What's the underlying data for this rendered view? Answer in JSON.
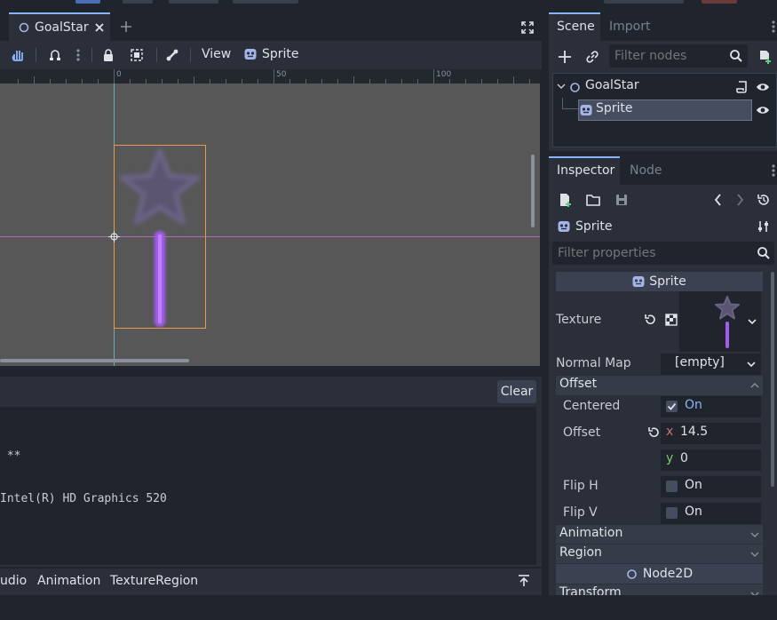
{
  "editor": {
    "scene_tab": {
      "label": "GoalStar"
    },
    "toolbar": {
      "view_label": "View",
      "sprite_label": "Sprite"
    },
    "ruler": {
      "ticks": [
        "0",
        "50",
        "100"
      ]
    }
  },
  "output": {
    "clear_label": "Clear",
    "lines": [
      " **",
      "Intel(R) HD Graphics 520",
      "",
      " **"
    ]
  },
  "bottom_tabs": [
    "udio",
    "Animation",
    "TextureRegion"
  ],
  "scene_panel": {
    "tabs": [
      "Scene",
      "Import"
    ],
    "filter_placeholder": "Filter nodes",
    "tree": [
      {
        "label": "GoalStar"
      },
      {
        "label": "Sprite"
      }
    ]
  },
  "inspector": {
    "tabs": [
      "Inspector",
      "Node"
    ],
    "node_name": "Sprite",
    "filter_placeholder": "Filter properties",
    "section_title": "Sprite",
    "texture_label": "Texture",
    "normal_map": {
      "label": "Normal Map",
      "value": "[empty]"
    },
    "offset_group": "Offset",
    "centered": {
      "label": "Centered",
      "value": "On",
      "checked": true
    },
    "offset": {
      "label": "Offset",
      "x_label": "x",
      "x": "14.5",
      "y_label": "y",
      "y": "0"
    },
    "flip_h": {
      "label": "Flip H",
      "value": "On",
      "checked": false
    },
    "flip_v": {
      "label": "Flip V",
      "value": "On",
      "checked": false
    },
    "animation_group": "Animation",
    "region_group": "Region",
    "node2d_title": "Node2D",
    "transform_group": "Transform"
  },
  "colors": {
    "accent": "#8ab4f8",
    "selection": "#464d5e",
    "sprite_rect": "#e79a4a",
    "purple": "#a45cf0",
    "canvas": "#575757"
  }
}
